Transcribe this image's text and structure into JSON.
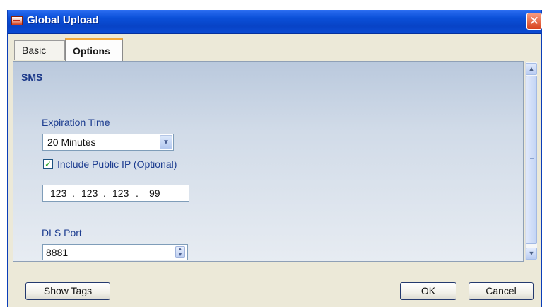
{
  "window": {
    "title": "Global Upload",
    "close_symbol": "✕"
  },
  "tabs": [
    {
      "label": "Basic",
      "active": false
    },
    {
      "label": "Options",
      "active": true
    }
  ],
  "section": {
    "title": "SMS"
  },
  "expiration": {
    "label": "Expiration Time",
    "selected": "20 Minutes"
  },
  "public_ip": {
    "checked": true,
    "label": "Include Public IP (Optional)",
    "octets": [
      "123",
      "123",
      "123",
      "99"
    ]
  },
  "dls_port": {
    "label": "DLS Port",
    "value": "8881"
  },
  "buttons": {
    "show_tags": "Show Tags",
    "ok": "OK",
    "cancel": "Cancel"
  },
  "icons": {
    "app": "app-logo-icon",
    "close": "close-icon",
    "dropdown": "chevron-down-icon",
    "check": "checkmark-icon",
    "spin": "spin-arrows-icon",
    "scroll_up": "scroll-up-icon",
    "scroll_down": "scroll-down-icon"
  },
  "colors": {
    "titlebar": "#0a4fd8",
    "tab_accent": "#f2a93a",
    "label_text": "#1d3d90",
    "check_mark": "#21a121"
  }
}
